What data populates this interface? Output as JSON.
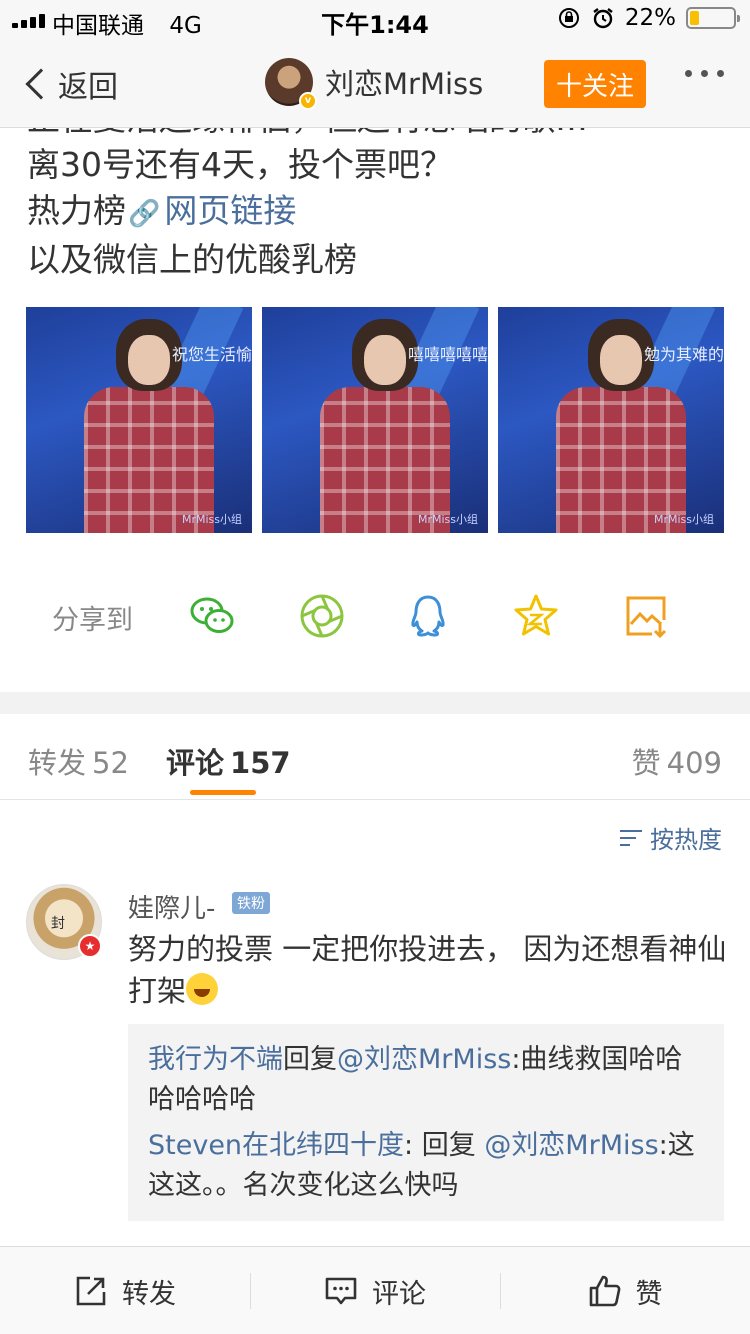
{
  "status_bar": {
    "carrier": "中国联通",
    "network": "4G",
    "time": "下午1:44",
    "battery_percent": "22%",
    "battery_level": 0.22
  },
  "nav": {
    "back_label": "返回",
    "title": "刘恋MrMiss",
    "follow_label": "十关注"
  },
  "post": {
    "clipped_line": "正在复活边缘徘徊，但还有想唱的歌…",
    "line1": "离30号还有4天，投个票吧？",
    "line2_prefix": "热力榜",
    "line2_link": "网页链接",
    "line3": "以及微信上的优酸乳榜",
    "images": [
      {
        "caption": "祝您生活愉",
        "watermark": "MrMiss小组"
      },
      {
        "caption": "嘻嘻嘻嘻嘻",
        "watermark": "MrMiss小组"
      },
      {
        "caption": "勉为其难的",
        "watermark": "MrMiss小组"
      }
    ]
  },
  "share": {
    "label": "分享到",
    "icons": [
      "wechat-icon",
      "moments-icon",
      "qq-icon",
      "qzone-icon",
      "save-image-icon"
    ]
  },
  "tabs": {
    "repost_label": "转发",
    "repost_count": "52",
    "comment_label": "评论",
    "comment_count": "157",
    "like_label": "赞",
    "like_count": "409"
  },
  "sort_label": "按热度",
  "comment": {
    "user": "娃際儿-",
    "badge": "铁粉",
    "avatar_text": "封",
    "text": "努力的投票 一定把你投进去， 因为还想看神仙打架",
    "replies": [
      {
        "user": "我行为不端",
        "connector": "回复",
        "target": "@刘恋MrMiss",
        "text": ":曲线救国哈哈哈哈哈哈"
      },
      {
        "user": "Steven在北纬四十度",
        "connector": ": 回复 ",
        "target": "@刘恋MrMiss",
        "text": ":这这这。。名次变化这么快吗"
      }
    ]
  },
  "bottom_bar": {
    "repost": "转发",
    "comment": "评论",
    "like": "赞"
  },
  "colors": {
    "accent_orange": "#ff8200",
    "link_blue": "#4a6f9c",
    "wechat_green": "#3cb034",
    "qq_blue": "#3d8fd8",
    "qzone_yellow": "#f2c200",
    "save_orange": "#f0a020"
  }
}
